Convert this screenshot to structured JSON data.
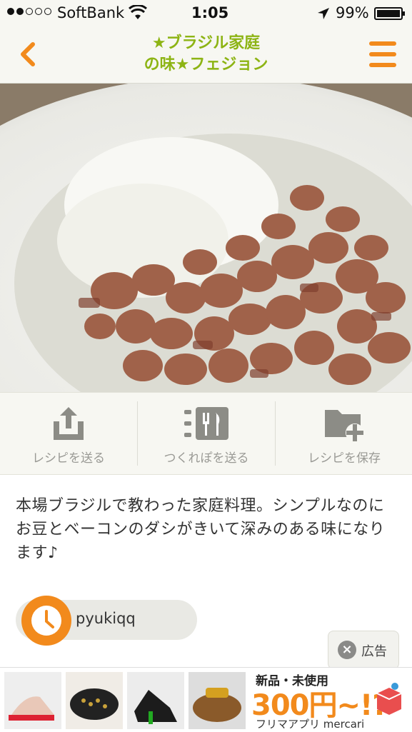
{
  "status_bar": {
    "carrier": "SoftBank",
    "time": "1:05",
    "battery": "99%"
  },
  "header": {
    "title_line1": "★ブラジル家庭",
    "title_line2": "の味★フェジョン",
    "back_icon": "chevron-left-icon",
    "menu_icon": "hamburger-menu-icon"
  },
  "photo": {
    "subject": "recipe-photo"
  },
  "actions": [
    {
      "label": "レシピを送る",
      "icon": "share-icon"
    },
    {
      "label": "つくれぽを送る",
      "icon": "cooking-report-icon"
    },
    {
      "label": "レシピを保存",
      "icon": "folder-add-icon"
    }
  ],
  "description": "本場ブラジルで教わった家庭料理。シンプルなのにお豆とベーコンのダシがきいて深みのある味になります♪",
  "author": {
    "name": "pyukiqq",
    "avatar_icon": "clock-avatar-icon"
  },
  "ad": {
    "label": "広告",
    "close_icon": "close-icon",
    "headline": "新品・未使用",
    "price": "300円~!?",
    "brand": "フリマアプリ mercari"
  },
  "colors": {
    "accent_orange": "#f28a1c",
    "title_green": "#8db414",
    "bar_bg": "#f7f7f2"
  }
}
